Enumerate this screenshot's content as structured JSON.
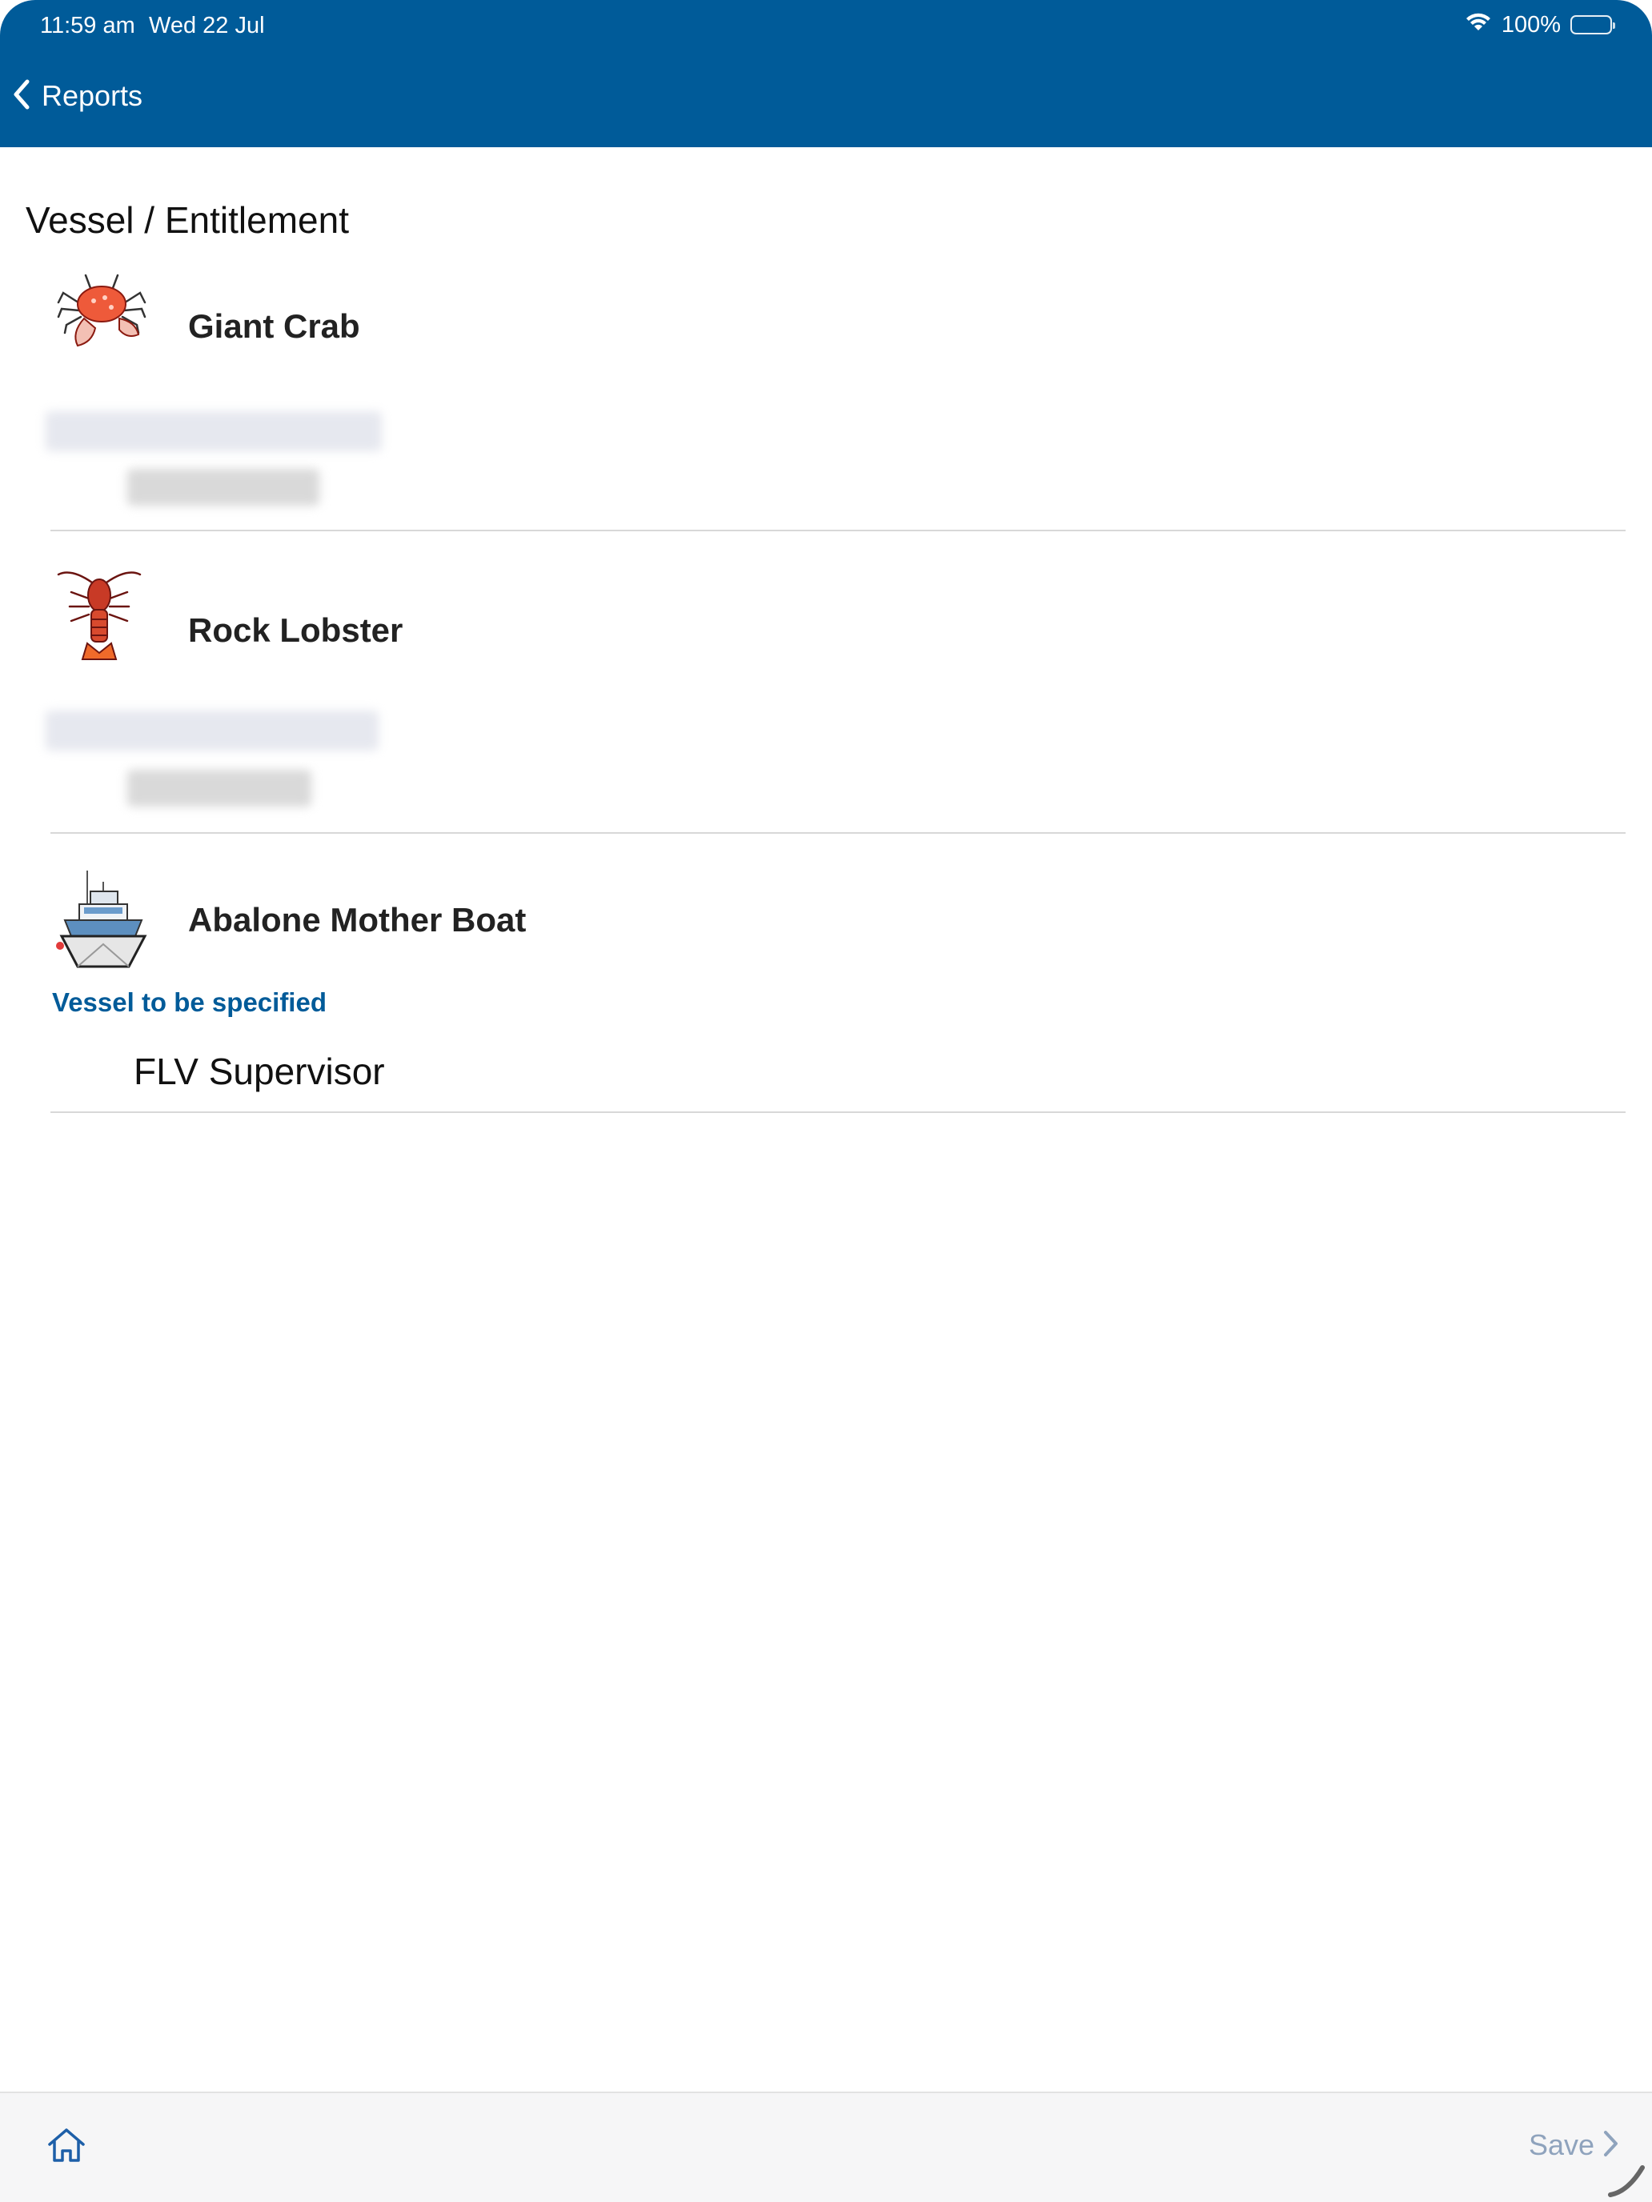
{
  "status_bar": {
    "time": "11:59 am",
    "date": "Wed 22 Jul",
    "battery": "100%",
    "icons": [
      "wifi-icon",
      "battery-icon"
    ]
  },
  "nav": {
    "back_label": "Reports",
    "back_icon": "chevron-left-icon"
  },
  "section": {
    "title": "Vessel / Entitlement"
  },
  "entitlements": [
    {
      "icon": "crab-icon",
      "title": "Giant Crab"
    },
    {
      "icon": "lobster-icon",
      "title": "Rock Lobster"
    },
    {
      "icon": "boat-icon",
      "title": "Abalone Mother Boat",
      "note": "Vessel to be specified",
      "role": "FLV Supervisor"
    }
  ],
  "bottom_bar": {
    "home_icon": "home-icon",
    "save_label": "Save",
    "save_icon": "chevron-right-icon"
  },
  "colors": {
    "header": "#005b99",
    "accent": "#005b99",
    "disabled": "#8fa3bd"
  }
}
